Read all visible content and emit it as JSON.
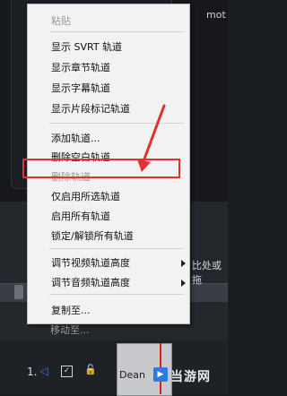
{
  "background": {
    "top_right_text": "mot",
    "mid_right_text": "比处或拖",
    "clip_label": "Dean",
    "track_number": "1."
  },
  "menu": {
    "items": [
      {
        "label": "粘贴",
        "enabled": false,
        "separator_after": true
      },
      {
        "label": "显示 SVRT 轨道",
        "enabled": true
      },
      {
        "label": "显示章节轨道",
        "enabled": true
      },
      {
        "label": "显示字幕轨道",
        "enabled": true
      },
      {
        "label": "显示片段标记轨道",
        "enabled": true,
        "separator_after": true
      },
      {
        "label": "添加轨道...",
        "enabled": true
      },
      {
        "label": "删除空白轨道",
        "enabled": true
      },
      {
        "label": "删除轨道",
        "enabled": false
      },
      {
        "label": "仅启用所选轨道",
        "enabled": true,
        "highlighted": true
      },
      {
        "label": "启用所有轨道",
        "enabled": true
      },
      {
        "label": "锁定/解锁所有轨道",
        "enabled": true,
        "separator_after": true
      },
      {
        "label": "调节视频轨道高度",
        "enabled": true,
        "submenu": true
      },
      {
        "label": "调节音频轨道高度",
        "enabled": true,
        "submenu": true,
        "separator_after": true
      },
      {
        "label": "复制至...",
        "enabled": true
      },
      {
        "label": "移动至...",
        "enabled": false
      }
    ]
  },
  "watermark": {
    "logo_text": "当游网"
  },
  "colors": {
    "highlight_border": "#e53030",
    "annotation_arrow": "#e53030",
    "menu_bg": "#f2f2f2"
  }
}
